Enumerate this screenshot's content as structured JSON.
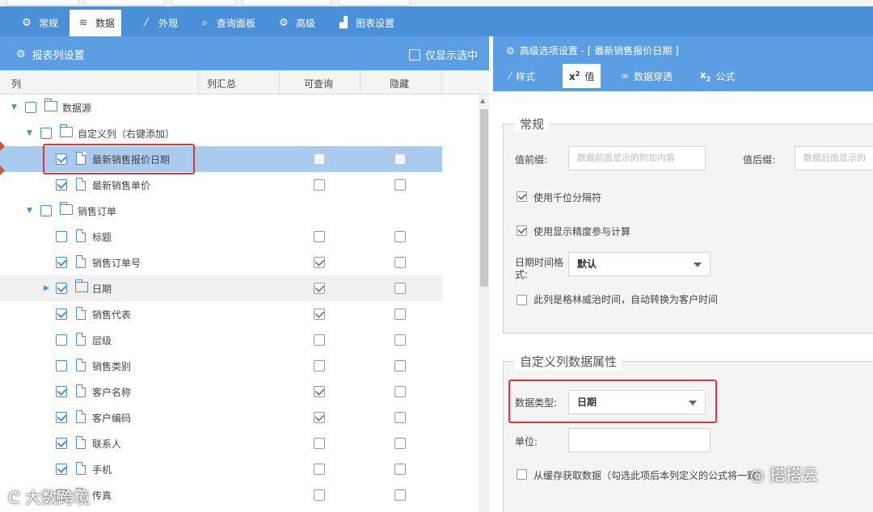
{
  "main_tabs": [
    {
      "label": "常规",
      "icon": "gear-icon"
    },
    {
      "label": "数据",
      "icon": "database-icon"
    },
    {
      "label": "外观",
      "icon": "magic-wand-icon"
    },
    {
      "label": "查询面板",
      "icon": "search-icon"
    },
    {
      "label": "高级",
      "icon": "gears-icon"
    },
    {
      "label": "图表设置",
      "icon": "chart-icon"
    }
  ],
  "left_panel": {
    "title": "报表列设置",
    "only_selected_label": "仅显示选中",
    "columns": [
      "列",
      "列汇总",
      "可查询",
      "隐藏"
    ],
    "rows": [
      {
        "label": "数据源",
        "checked": false
      },
      {
        "label": "自定义列（右键添加）",
        "checked": false
      },
      {
        "label": "最新销售报价日期",
        "checked": true
      },
      {
        "label": "最新销售单价",
        "checked": true
      },
      {
        "label": "销售订单",
        "checked": false
      },
      {
        "label": "标题",
        "checked": false
      },
      {
        "label": "销售订单号",
        "checked": true
      },
      {
        "label": "日期",
        "checked": true
      },
      {
        "label": "销售代表",
        "checked": true
      },
      {
        "label": "层级",
        "checked": false
      },
      {
        "label": "销售类别",
        "checked": false
      },
      {
        "label": "客户名称",
        "checked": true
      },
      {
        "label": "客户编码",
        "checked": true
      },
      {
        "label": "联系人",
        "checked": true
      },
      {
        "label": "手机",
        "checked": true
      },
      {
        "label": "传真",
        "checked": false
      }
    ]
  },
  "right_panel": {
    "title": "高级选项设置 - [ 最新销售报价日期 ]",
    "tabs": [
      {
        "label": "样式",
        "icon": "magic-wand-icon"
      },
      {
        "label": "值",
        "prefix": "x",
        "sup": "2",
        "icon": "x-squared-icon"
      },
      {
        "label": "数据穿透",
        "icon": "link-icon"
      },
      {
        "label": "公式",
        "prefix": "x",
        "sub": "2",
        "icon": "x-sub-icon"
      }
    ],
    "general": {
      "legend": "常规",
      "prefix_label": "值前缀:",
      "prefix_placeholder": "数据前面显示的附加内容",
      "suffix_label": "值后缀:",
      "suffix_placeholder": "数据后面显示的",
      "thousand_sep": "使用千位分隔符",
      "use_precision": "使用显示精度参与计算",
      "date_format_label": "日期时间格式:",
      "date_format_value": "默认",
      "gmt_label": "此列是格林威治时间，自动转换为客户时间"
    },
    "custom": {
      "legend": "自定义列数据属性",
      "type_label": "数据类型:",
      "type_value": "日期",
      "unit_label": "单位:",
      "cache_label": "从缓存获取数据（勾选此项后本列定义的公式将一致）"
    }
  },
  "watermarks": {
    "left": "大数跨境",
    "right": "搭搭云"
  },
  "colors": {
    "tab_bar": "#4a90d9",
    "panel_header": "#5c9ee3",
    "selected_row": "#a9cbee",
    "highlight_border": "#d9363e"
  }
}
